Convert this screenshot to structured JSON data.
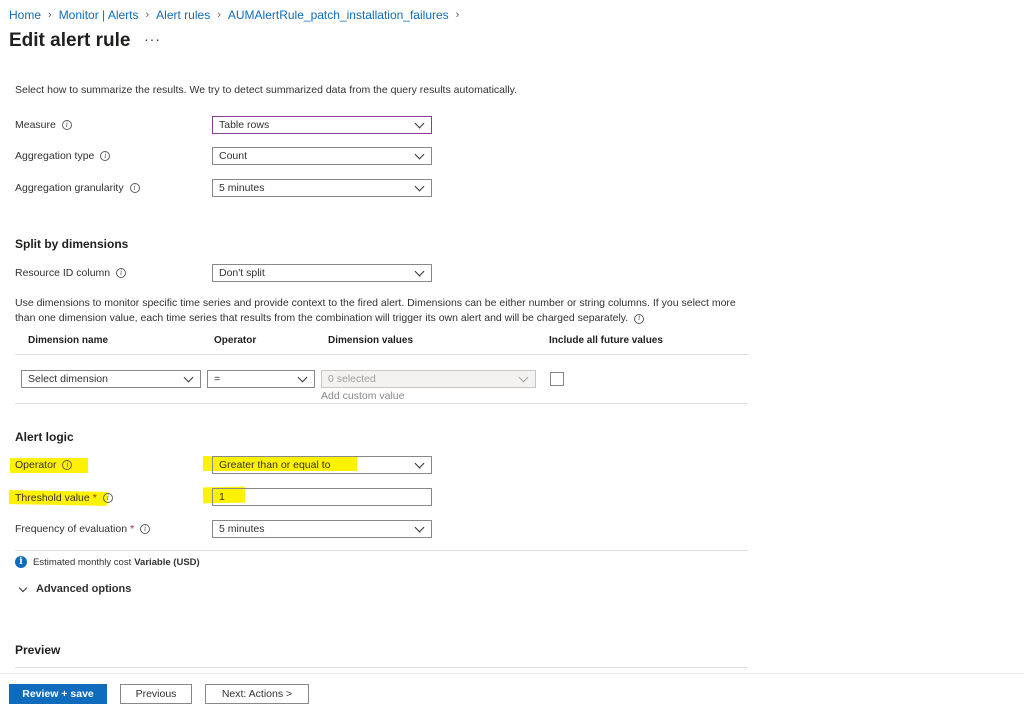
{
  "breadcrumb": [
    "Home",
    "Monitor | Alerts",
    "Alert rules",
    "AUMAlertRule_patch_installation_failures"
  ],
  "page_title": "Edit alert rule",
  "more_label": "···",
  "summary_text": "Select how to summarize the results. We try to detect summarized data from the query results automatically.",
  "measure": {
    "label": "Measure",
    "value": "Table rows"
  },
  "aggregation_type": {
    "label": "Aggregation type",
    "value": "Count"
  },
  "aggregation_granularity": {
    "label": "Aggregation granularity",
    "value": "5 minutes"
  },
  "split": {
    "heading": "Split by dimensions",
    "resource_label": "Resource ID column",
    "resource_value": "Don't split",
    "description": "Use dimensions to monitor specific time series and provide context to the fired alert. Dimensions can be either number or string columns. If you select more",
    "description2": "than one dimension value, each time series that results from the combination will trigger its own alert and will be charged separately.",
    "columns": [
      "Dimension name",
      "Operator",
      "Dimension values",
      "Include all future values"
    ],
    "row": {
      "dimension": "Select dimension",
      "operator": "=",
      "values": "0 selected",
      "add_custom": "Add custom value"
    }
  },
  "alert_logic": {
    "heading": "Alert logic",
    "operator_label": "Operator",
    "operator_value": "Greater than or equal to",
    "threshold_label": "Threshold value",
    "threshold_value": "1",
    "frequency_label": "Frequency of evaluation",
    "frequency_value": "5 minutes",
    "required_mark": "*"
  },
  "cost": {
    "prefix": "Estimated monthly cost",
    "value": "Variable (USD)"
  },
  "advanced_label": "Advanced options",
  "preview_heading": "Preview",
  "footer": {
    "review_save": "Review + save",
    "previous": "Previous",
    "next": "Next: Actions >"
  },
  "colors": {
    "accent": "#0f6cbd",
    "highlight": "#fff200",
    "focus_border": "#8d3a9b"
  }
}
